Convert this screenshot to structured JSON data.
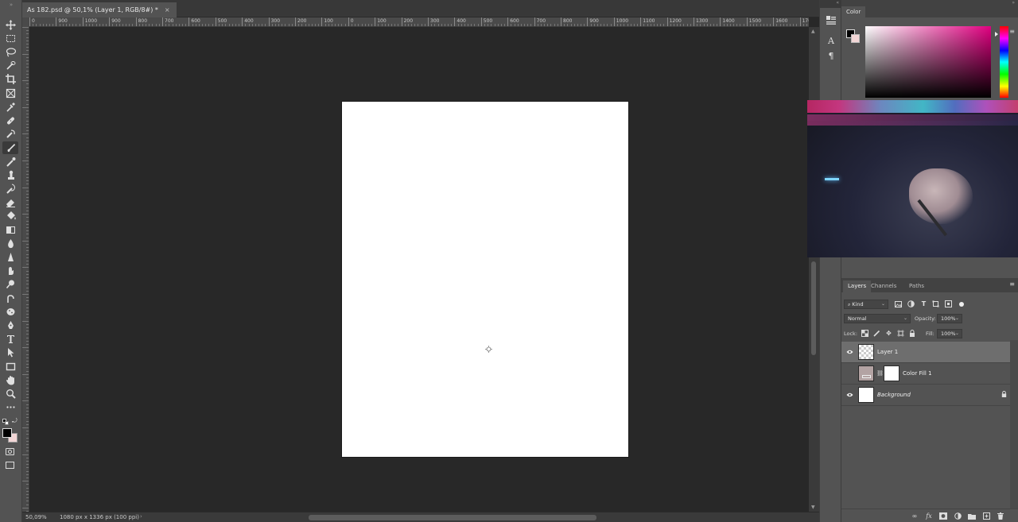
{
  "document": {
    "tab_title": "As 182.psd @ 50,1% (Layer 1, RGB/8#) *",
    "close_glyph": "×"
  },
  "ruler": {
    "top_labels": [
      "0",
      "900",
      "1000",
      "900",
      "800",
      "700",
      "600",
      "500",
      "400",
      "300",
      "200",
      "100",
      "0",
      "100",
      "200",
      "300",
      "400",
      "500",
      "600",
      "700",
      "800",
      "900",
      "1000",
      "1100",
      "1200",
      "1300",
      "1400",
      "1500",
      "1600",
      "1700"
    ]
  },
  "toolbar": {
    "tools": [
      {
        "name": "move-tool-icon",
        "glyph": "move"
      },
      {
        "name": "marquee-tool-icon",
        "glyph": "marquee"
      },
      {
        "name": "lasso-tool-icon",
        "glyph": "lasso"
      },
      {
        "name": "quick-select-tool-icon",
        "glyph": "wand"
      },
      {
        "name": "crop-tool-icon",
        "glyph": "crop"
      },
      {
        "name": "frame-tool-icon",
        "glyph": "frame"
      },
      {
        "name": "eyedropper-tool-icon",
        "glyph": "eyedropper"
      },
      {
        "name": "healing-brush-tool-icon",
        "glyph": "heal"
      },
      {
        "name": "patch-tool-icon",
        "glyph": "patch"
      },
      {
        "name": "brush-tool-icon",
        "glyph": "brush",
        "active": true
      },
      {
        "name": "mixer-brush-tool-icon",
        "glyph": "brush2"
      },
      {
        "name": "clone-stamp-tool-icon",
        "glyph": "stamp"
      },
      {
        "name": "history-brush-tool-icon",
        "glyph": "history"
      },
      {
        "name": "eraser-tool-icon",
        "glyph": "eraser"
      },
      {
        "name": "paint-bucket-tool-icon",
        "glyph": "bucket"
      },
      {
        "name": "gradient-tool-icon",
        "glyph": "gradient"
      },
      {
        "name": "blur-tool-icon",
        "glyph": "blur"
      },
      {
        "name": "sharpen-tool-icon",
        "glyph": "sharpen"
      },
      {
        "name": "smudge-tool-icon",
        "glyph": "smudge"
      },
      {
        "name": "dodge-tool-icon",
        "glyph": "dodge"
      },
      {
        "name": "burn-tool-icon",
        "glyph": "burn"
      },
      {
        "name": "sponge-tool-icon",
        "glyph": "sponge"
      },
      {
        "name": "pen-tool-icon",
        "glyph": "pen"
      },
      {
        "name": "type-tool-icon",
        "glyph": "type"
      },
      {
        "name": "path-select-tool-icon",
        "glyph": "arrow"
      },
      {
        "name": "rectangle-tool-icon",
        "glyph": "rect"
      },
      {
        "name": "hand-tool-icon",
        "glyph": "hand"
      },
      {
        "name": "zoom-tool-icon",
        "glyph": "zoom"
      },
      {
        "name": "more-tools-icon",
        "glyph": "more"
      }
    ],
    "foreground_color": "#000000",
    "background_color": "#f2d6d6"
  },
  "status": {
    "zoom": "50,09%",
    "doc_info": "1080 px x 1336 px (100 ppi)",
    "arrow": "›"
  },
  "color_panel": {
    "tab_label": "Color",
    "foreground_color": "#000000",
    "background_color": "#f2d6d6",
    "hue_color": "#e00080"
  },
  "layers_panel": {
    "tabs": [
      "Layers",
      "Channels",
      "Paths"
    ],
    "filter_kind": "Kind",
    "blend_mode": "Normal",
    "opacity_label": "Opacity:",
    "opacity_value": "100%",
    "lock_label": "Lock:",
    "fill_label": "Fill:",
    "fill_value": "100%",
    "layers": [
      {
        "name": "Layer 1",
        "visible": true,
        "selected": true,
        "thumb": "checker"
      },
      {
        "name": "Color Fill 1",
        "visible": false,
        "selected": false,
        "thumb": "fill"
      },
      {
        "name": "Background",
        "visible": true,
        "selected": false,
        "thumb": "white",
        "locked": true
      }
    ]
  },
  "side_column": {
    "buttons": [
      "properties-icon",
      "character-icon",
      "paragraph-icon"
    ]
  }
}
